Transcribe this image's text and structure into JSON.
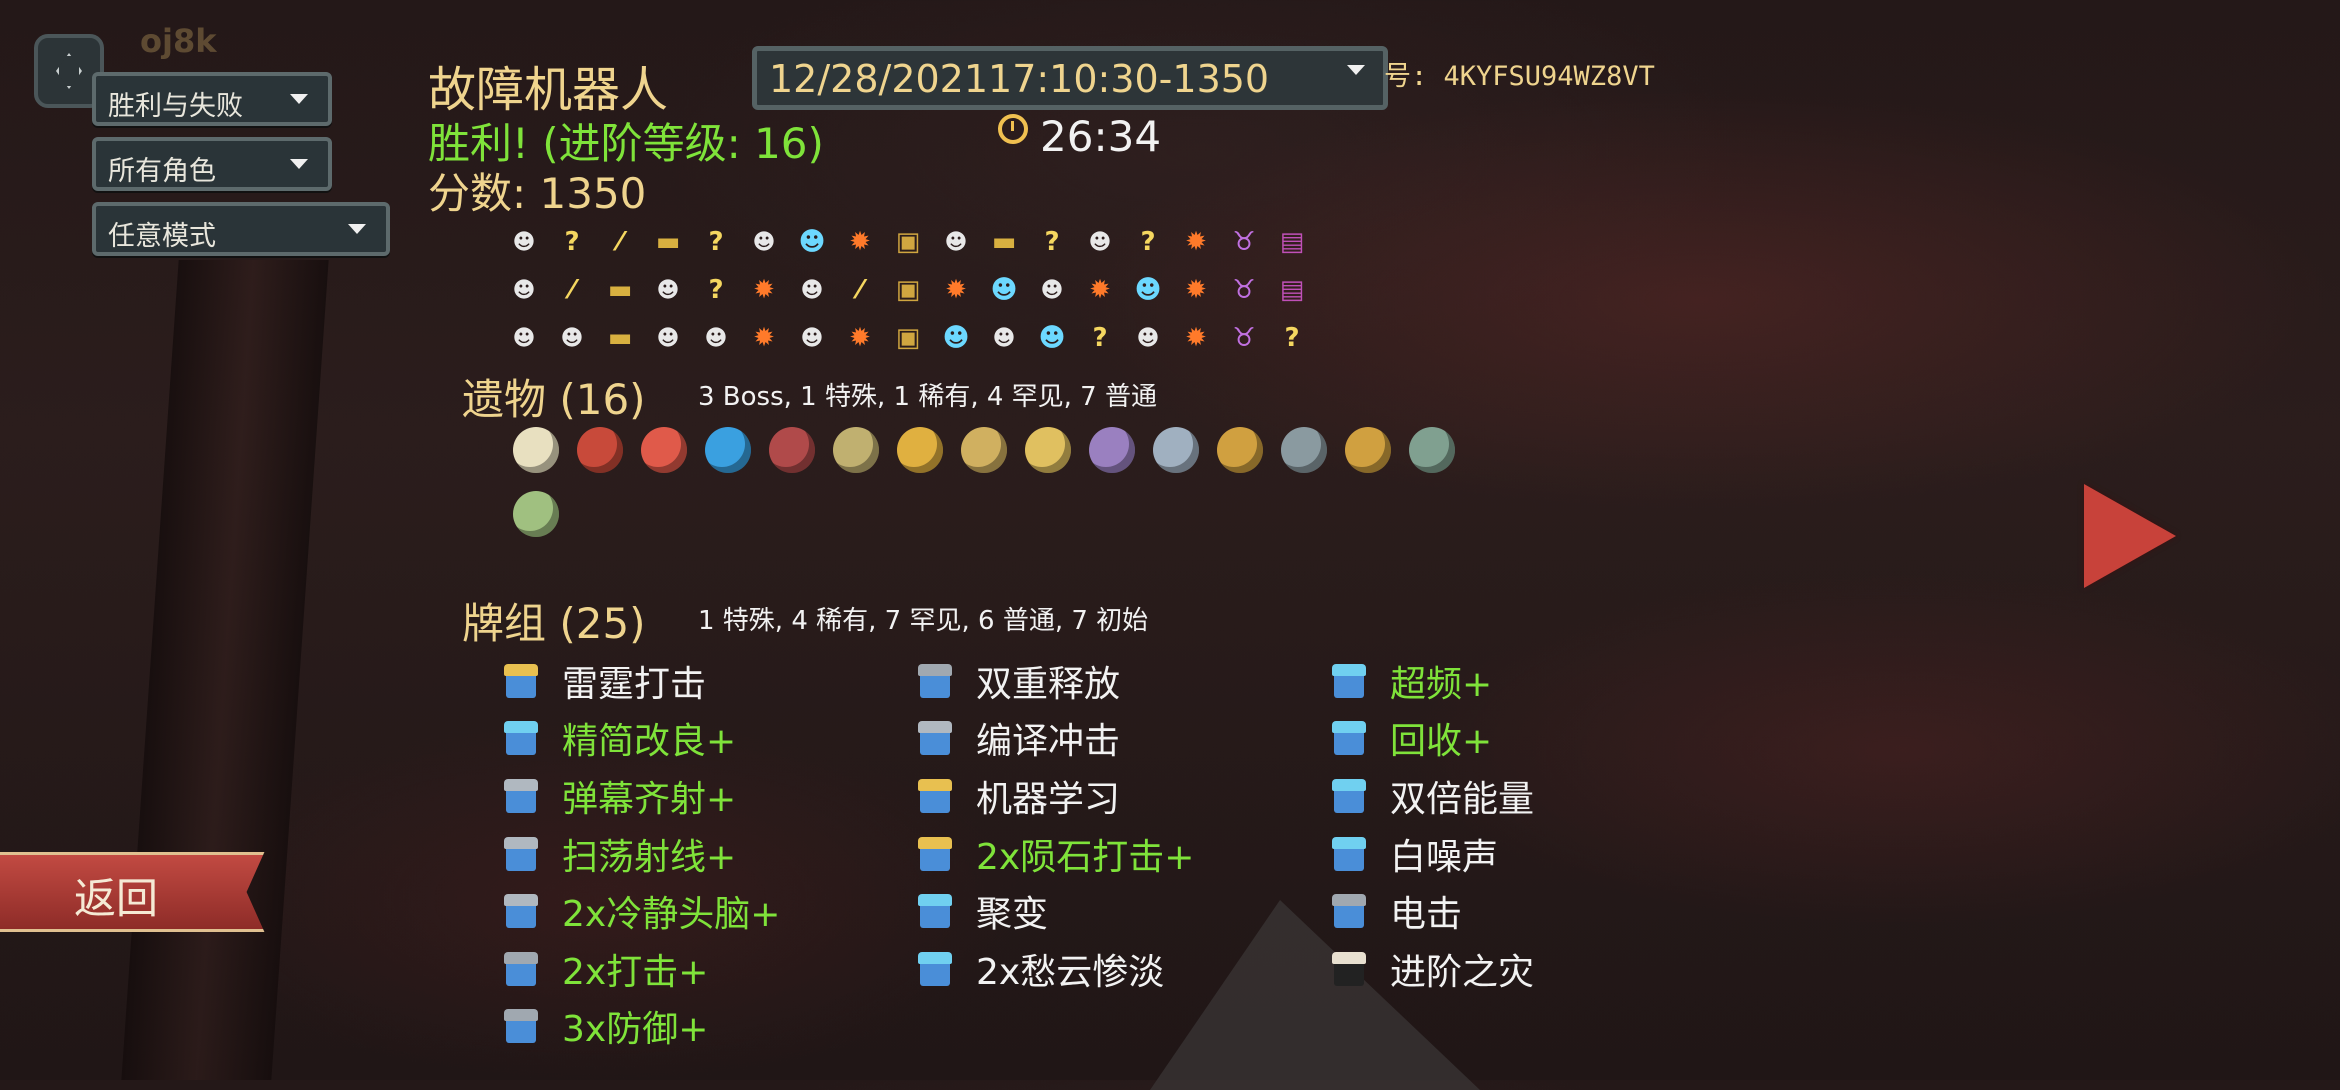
{
  "header": {
    "seed_button_icon": "diamond-icon",
    "faded_name": "oj8k",
    "title": "故障机器人",
    "run_select": "12/28/202117:10:30-1350",
    "seed": "号: 4KYFSU94WZ8VT",
    "victory": "胜利! (进阶等级: 16)",
    "timer_icon": "stopwatch-icon",
    "timer": "26:34",
    "score": "分数: 1350"
  },
  "filters": {
    "outcome": "胜利与失败",
    "character": "所有角色",
    "mode": "任意模式"
  },
  "map": {
    "legend": {
      "M": "monster-icon",
      "?": "unknown-room-icon",
      "E": "elite-icon",
      "R": "rest-site-icon",
      "T": "treasure-icon",
      "S": "merchant-icon",
      "B": "boss-icon",
      "C": "boss-chest-icon",
      "V": "event-icon",
      "Q": "question-elite-icon"
    },
    "rows": [
      [
        "M",
        "?",
        "Q",
        "R",
        "?",
        "M",
        "V",
        "E",
        "T",
        "M",
        "R",
        "?",
        "M",
        "?",
        "E",
        "B",
        "C"
      ],
      [
        "M",
        "Q",
        "R",
        "M",
        "?",
        "E",
        "M",
        "Q",
        "T",
        "E",
        "V",
        "M",
        "E",
        "V",
        "E",
        "B",
        "C"
      ],
      [
        "M",
        "M",
        "R",
        "M",
        "M",
        "E",
        "M",
        "E",
        "T",
        "V",
        "M",
        "V",
        "?",
        "M",
        "E",
        "B",
        "?"
      ]
    ]
  },
  "relics": {
    "title": "遗物 (16)",
    "summary": "3  Boss, 1  特殊, 1  稀有, 4  罕见, 7  普通",
    "items": [
      {
        "icon": "eye-orb-relic-icon",
        "color": "#e8e0c0"
      },
      {
        "icon": "torii-relic-icon",
        "color": "#c84a3a"
      },
      {
        "icon": "tag-relic-icon",
        "color": "#e05a4a"
      },
      {
        "icon": "potion-relic-icon",
        "color": "#3aa0e0"
      },
      {
        "icon": "anvil-relic-icon",
        "color": "#b04a4a"
      },
      {
        "icon": "idol-relic-icon",
        "color": "#c0b070"
      },
      {
        "icon": "horn-relic-icon",
        "color": "#e0b040"
      },
      {
        "icon": "hook-relic-icon",
        "color": "#d0b060"
      },
      {
        "icon": "pen-relic-icon",
        "color": "#e0c060"
      },
      {
        "icon": "disc-relic-icon",
        "color": "#9a80c0"
      },
      {
        "icon": "beads-relic-icon",
        "color": "#a0b0c0"
      },
      {
        "icon": "hammer-relic-icon",
        "color": "#d0a040"
      },
      {
        "icon": "kunai-relic-icon",
        "color": "#8a9aa0"
      },
      {
        "icon": "vajra-relic-icon",
        "color": "#d0a040"
      },
      {
        "icon": "teapot-relic-icon",
        "color": "#80a090"
      },
      {
        "icon": "ladder-relic-icon",
        "color": "#a0c080"
      }
    ]
  },
  "deck": {
    "title": "牌组 (25)",
    "summary": "1  特殊, 4  稀有, 7  罕见, 6  普通, 7  初始",
    "columns": [
      [
        {
          "label": "雷霆打击",
          "upgraded": false,
          "rarity": "rare"
        },
        {
          "label": "精简改良+",
          "upgraded": true,
          "rarity": "uncommon"
        },
        {
          "label": "弹幕齐射+",
          "upgraded": true,
          "rarity": "common"
        },
        {
          "label": "扫荡射线+",
          "upgraded": true,
          "rarity": "common"
        },
        {
          "label": "2x冷静头脑+",
          "upgraded": true,
          "rarity": "common"
        },
        {
          "label": "2x打击+",
          "upgraded": true,
          "rarity": "starter"
        },
        {
          "label": "3x防御+",
          "upgraded": true,
          "rarity": "starter"
        }
      ],
      [
        {
          "label": "双重释放",
          "upgraded": false,
          "rarity": "starter"
        },
        {
          "label": "编译冲击",
          "upgraded": false,
          "rarity": "common"
        },
        {
          "label": "机器学习",
          "upgraded": false,
          "rarity": "rare"
        },
        {
          "label": "2x陨石打击+",
          "upgraded": true,
          "rarity": "rare"
        },
        {
          "label": "聚变",
          "upgraded": false,
          "rarity": "uncommon"
        },
        {
          "label": "2x愁云惨淡",
          "upgraded": false,
          "rarity": "uncommon"
        }
      ],
      [
        {
          "label": "超频+",
          "upgraded": true,
          "rarity": "uncommon"
        },
        {
          "label": "回收+",
          "upgraded": true,
          "rarity": "uncommon"
        },
        {
          "label": "双倍能量",
          "upgraded": false,
          "rarity": "uncommon"
        },
        {
          "label": "白噪声",
          "upgraded": false,
          "rarity": "uncommon"
        },
        {
          "label": "电击",
          "upgraded": false,
          "rarity": "starter"
        },
        {
          "label": "进阶之灾",
          "upgraded": false,
          "rarity": "curse"
        }
      ]
    ],
    "rarity_colors": {
      "rare": "#e8c050",
      "uncommon": "#70d0f0",
      "common": "#b0b8c0",
      "starter": "#a0a8b0",
      "curse": "#e8e0d0"
    }
  },
  "nav": {
    "back_label": "返回",
    "proceed_icon": "right-arrow-icon"
  }
}
